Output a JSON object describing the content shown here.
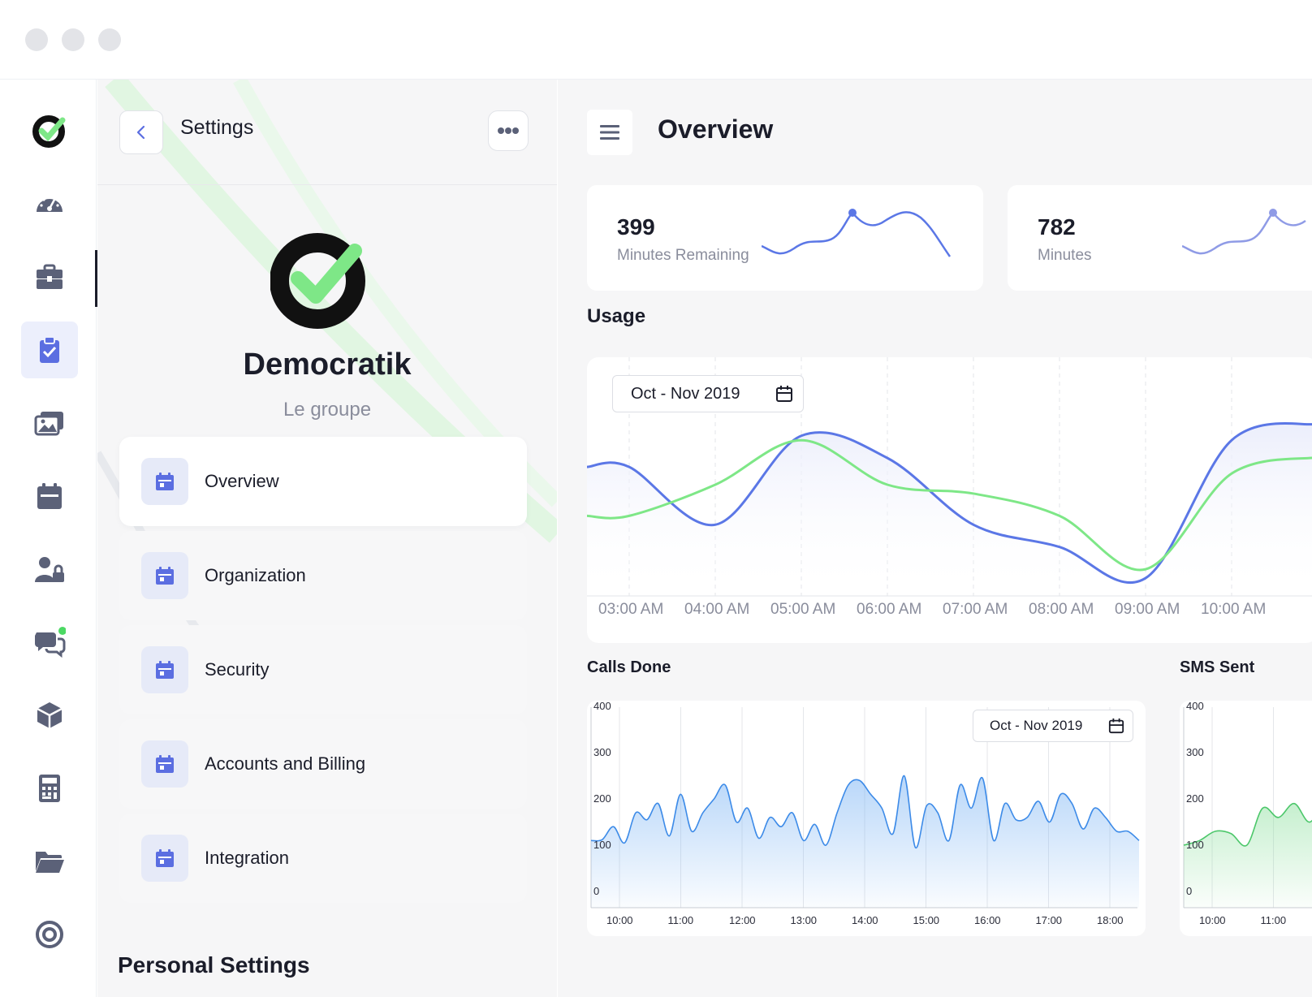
{
  "colors": {
    "accent": "#5b6ee1",
    "green": "#7ee787",
    "blue": "#5b77e6",
    "text": "#1b1d2a",
    "muted": "#8a8d9c"
  },
  "rail": {
    "icons": [
      "speedometer-icon",
      "toolbox-icon",
      "clipboard-check-icon",
      "images-icon",
      "calendar-icon",
      "user-lock-icon",
      "chat-icon",
      "box-icon",
      "calculator-icon",
      "folder-icon",
      "target-icon"
    ],
    "active_index": 2
  },
  "panel": {
    "title": "Settings",
    "org_name": "Democratik",
    "org_sub": "Le groupe",
    "menu": [
      {
        "label": "Overview",
        "icon": "calendar-icon"
      },
      {
        "label": "Organization",
        "icon": "calendar-icon"
      },
      {
        "label": "Security",
        "icon": "calendar-icon"
      },
      {
        "label": "Accounts and Billing",
        "icon": "calendar-icon"
      },
      {
        "label": "Integration",
        "icon": "calendar-icon"
      }
    ],
    "personal_heading": "Personal Settings"
  },
  "main": {
    "title": "Overview",
    "stats": [
      {
        "value": "399",
        "label": "Minutes Remaining"
      },
      {
        "value": "782",
        "label": "Minutes"
      }
    ],
    "usage_title": "Usage",
    "usage_date": "Oct - Nov 2019",
    "calls_title": "Calls Done",
    "calls_date": "Oct - Nov 2019",
    "sms_title": "SMS Sent"
  },
  "chart_data": [
    {
      "type": "line",
      "title": "Usage",
      "x": [
        "03:00 AM",
        "04:00 AM",
        "05:00 AM",
        "06:00 AM",
        "07:00 AM",
        "08:00 AM",
        "09:00 AM",
        "10:00 AM"
      ],
      "series": [
        {
          "color": "#5b77e6",
          "values": [
            0.58,
            0.32,
            0.72,
            0.62,
            0.32,
            0.22,
            0.08,
            0.7
          ]
        },
        {
          "color": "#7ee787",
          "values": [
            0.36,
            0.5,
            0.7,
            0.5,
            0.46,
            0.36,
            0.12,
            0.55
          ]
        }
      ],
      "grid": true
    },
    {
      "type": "area",
      "title": "Calls Done",
      "x": [
        "10:00",
        "11:00",
        "12:00",
        "13:00",
        "14:00",
        "15:00",
        "16:00",
        "17:00",
        "18:00"
      ],
      "yticks": [
        0,
        100,
        200,
        300,
        400
      ],
      "ylim": [
        0,
        400
      ],
      "series": [
        {
          "color": "#3d8be8",
          "values": [
            110,
            112,
            140,
            105,
            170,
            155,
            190,
            120,
            210,
            130,
            170,
            200,
            230,
            150,
            180,
            115,
            160,
            140,
            170,
            110,
            145,
            100,
            170,
            230,
            240,
            210,
            180,
            125,
            250,
            95,
            185,
            170,
            110,
            230,
            180,
            245,
            110,
            190,
            155,
            160,
            195,
            150,
            210,
            190,
            135,
            180,
            160,
            130,
            130,
            110
          ]
        }
      ]
    },
    {
      "type": "area",
      "title": "SMS Sent",
      "x": [
        "10:00",
        "11:00"
      ],
      "yticks": [
        0,
        100,
        200,
        300,
        400
      ],
      "ylim": [
        0,
        400
      ],
      "series": [
        {
          "color": "#4cc76a",
          "values": [
            100,
            110,
            130,
            125,
            100,
            180,
            160,
            190,
            150,
            210
          ]
        }
      ]
    }
  ]
}
